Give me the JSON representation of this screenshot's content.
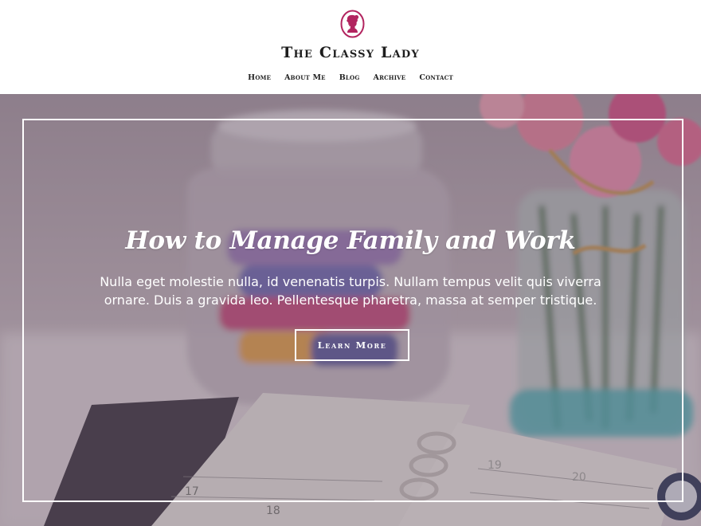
{
  "header": {
    "logo_icon": "lady-silhouette-icon",
    "brand_color": "#b2245f",
    "site_title": "The Classy Lady"
  },
  "nav": {
    "items": [
      {
        "label": "Home"
      },
      {
        "label": "About Me"
      },
      {
        "label": "Blog"
      },
      {
        "label": "Archive"
      },
      {
        "label": "Contact"
      }
    ]
  },
  "hero": {
    "title": "How to Manage Family and Work",
    "text": "Nulla eget molestie nulla, id venenatis turpis. Nullam tempus velit quis viverra ornare. Duis a gravida leo. Pellentesque pharetra, massa at semper tristique.",
    "button_label": "Learn More",
    "planner_dates": [
      "17",
      "18",
      "19",
      "20"
    ]
  }
}
